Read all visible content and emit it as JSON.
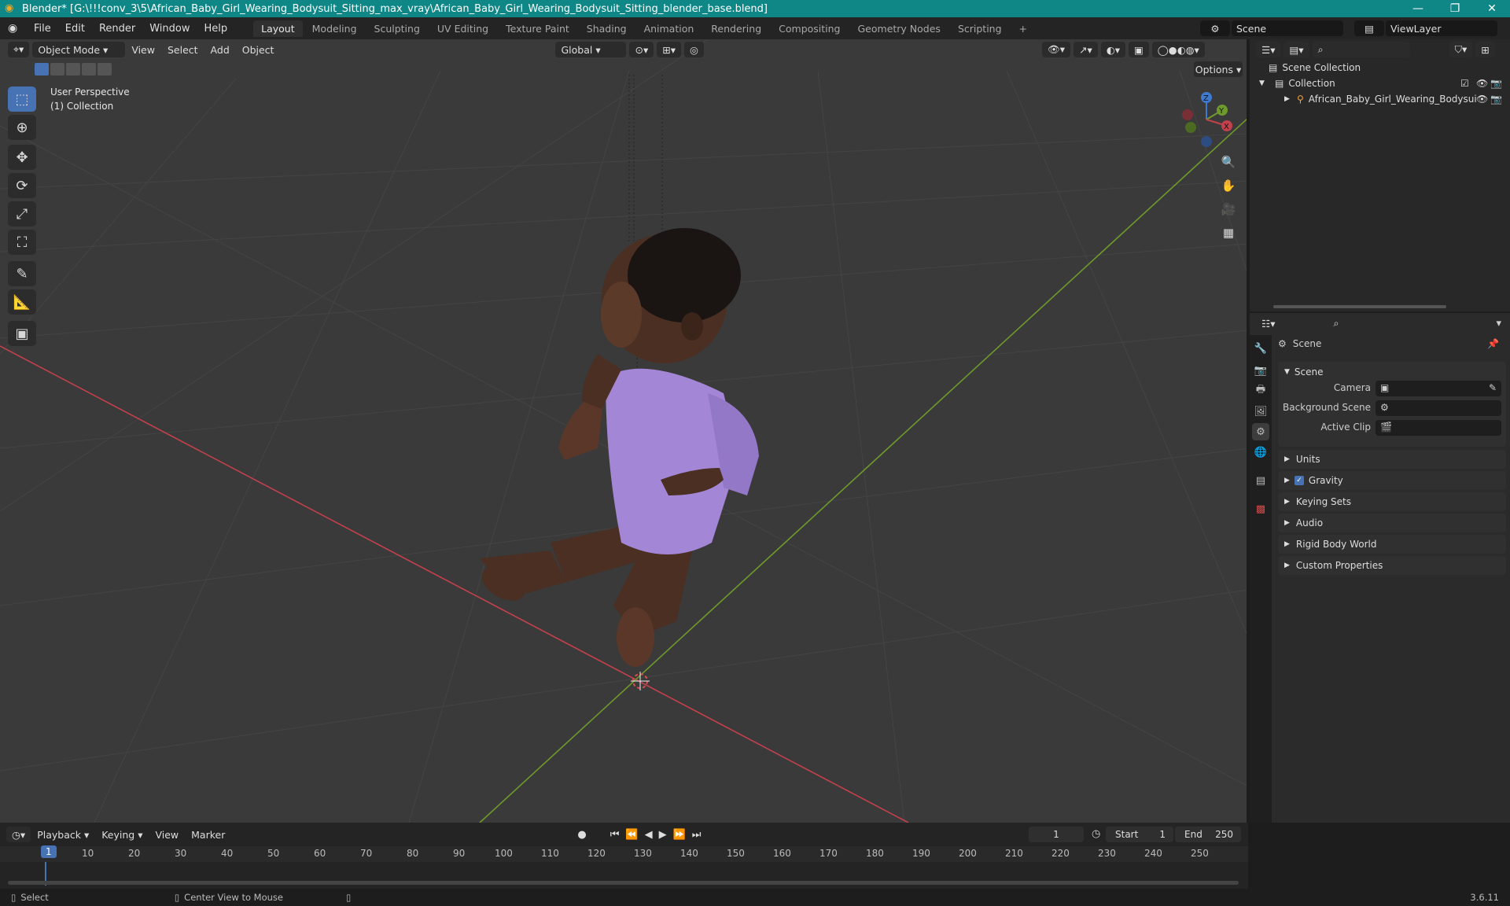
{
  "window": {
    "title": "Blender* [G:\\!!!conv_3\\5\\African_Baby_Girl_Wearing_Bodysuit_Sitting_max_vray\\African_Baby_Girl_Wearing_Bodysuit_Sitting_blender_base.blend]",
    "minimize": "—",
    "restore": "❐",
    "close": "✕"
  },
  "menu": {
    "items": [
      "File",
      "Edit",
      "Render",
      "Window",
      "Help"
    ],
    "workspaces": [
      "Layout",
      "Modeling",
      "Sculpting",
      "UV Editing",
      "Texture Paint",
      "Shading",
      "Animation",
      "Rendering",
      "Compositing",
      "Geometry Nodes",
      "Scripting"
    ],
    "active_workspace": "Layout",
    "add_workspace": "+",
    "scene": "Scene",
    "view_layer": "ViewLayer"
  },
  "viewport": {
    "mode": "Object Mode",
    "menus": [
      "View",
      "Select",
      "Add",
      "Object"
    ],
    "orientation": "Global",
    "options": "Options",
    "overlay_line1": "User Perspective",
    "overlay_line2": "(1) Collection",
    "gizmo_axes": [
      "X",
      "Y",
      "Z"
    ],
    "colors": {
      "x_axis": "#c2414c",
      "y_axis": "#6e9a2b",
      "body": "#4a2f22",
      "bodysuit": "#a486d6"
    }
  },
  "outliner": {
    "root": "Scene Collection",
    "collection": "Collection",
    "object": "African_Baby_Girl_Wearing_Bodysui"
  },
  "properties": {
    "context": "Scene",
    "panel": "Scene",
    "camera_label": "Camera",
    "bg_scene_label": "Background Scene",
    "active_clip_label": "Active Clip",
    "sections": [
      "Units",
      "Gravity",
      "Keying Sets",
      "Audio",
      "Rigid Body World",
      "Custom Properties"
    ]
  },
  "timeline": {
    "menus": [
      "Playback",
      "Keying",
      "View",
      "Marker"
    ],
    "current_frame": "1",
    "start_label": "Start",
    "start": "1",
    "end_label": "End",
    "end": "250",
    "ticks": [
      "1",
      "10",
      "20",
      "30",
      "40",
      "50",
      "60",
      "70",
      "80",
      "90",
      "100",
      "110",
      "120",
      "130",
      "140",
      "150",
      "160",
      "170",
      "180",
      "190",
      "200",
      "210",
      "220",
      "230",
      "240",
      "250"
    ]
  },
  "status": {
    "select": "Select",
    "center": "Center View to Mouse",
    "version": "3.6.11"
  }
}
